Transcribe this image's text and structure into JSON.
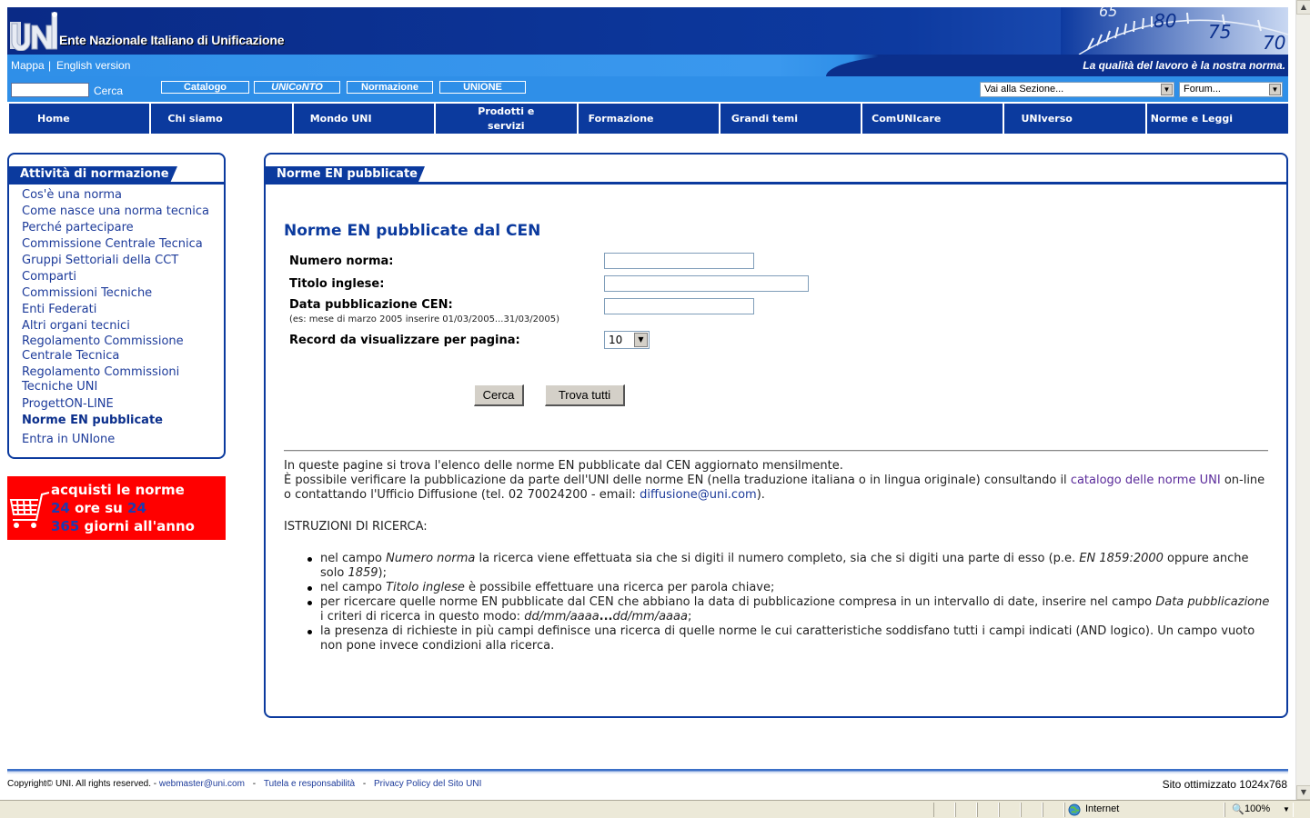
{
  "header": {
    "org_name": "Ente Nazionale Italiano di Unificazione",
    "gauge_numbers": [
      "65",
      "80",
      "75",
      "70"
    ],
    "links": [
      "Mappa",
      "English version"
    ],
    "link_separator": "|",
    "slogan": "La qualità del lavoro è la nostra norma.",
    "search_label": "Cerca",
    "search_value": "",
    "buttons": [
      "Catalogo",
      "UNICoNTO",
      "Normazione",
      "UNIONE"
    ],
    "section_select": "Vai alla Sezione...",
    "forum_select": "Forum..."
  },
  "nav": [
    {
      "label": "Home"
    },
    {
      "label": "Chi siamo"
    },
    {
      "label": "Mondo UNI"
    },
    {
      "label": "Prodotti e servizi"
    },
    {
      "label": "Formazione"
    },
    {
      "label": "Grandi temi"
    },
    {
      "label": "ComUNIcare"
    },
    {
      "label": "UNIverso"
    },
    {
      "label": "Norme e Leggi"
    }
  ],
  "sidebar": {
    "title": "Attività di normazione",
    "items": [
      "Cos'è una norma",
      "Come nasce una norma tecnica",
      "Perché partecipare",
      "Commissione Centrale Tecnica",
      "Gruppi Settoriali della CCT",
      "Comparti",
      "Commissioni Tecniche",
      "Enti Federati",
      "Altri organi tecnici",
      "Regolamento Commissione Centrale Tecnica",
      "Regolamento Commissioni Tecniche UNI",
      "ProgettON-LINE",
      "Norme EN pubblicate",
      "Entra in UNIone"
    ],
    "active_item": "Norme EN pubblicate"
  },
  "promo": {
    "line1": "acquisti le norme",
    "line2_num1": "24",
    "line2_text": " ore su ",
    "line2_num2": "24",
    "line3_num": "365",
    "line3_text": " giorni all'anno"
  },
  "content": {
    "tab_title": "Norme EN pubblicate",
    "heading": "Norme EN pubblicate dal CEN",
    "form": {
      "numero_label": "Numero norma:",
      "numero_value": "",
      "titolo_label": "Titolo inglese:",
      "titolo_value": "",
      "data_label": "Data pubblicazione CEN:",
      "data_hint": "(es: mese di marzo 2005 inserire 01/03/2005...31/03/2005)",
      "data_value": "",
      "records_label": "Record da visualizzare per pagina:",
      "records_value": "10",
      "cerca_button": "Cerca",
      "trova_button": "Trova tutti"
    },
    "intro1": "In queste pagine si trova l'elenco delle norme EN pubblicate dal CEN aggiornato mensilmente.",
    "intro2_a": "È possibile verificare la pubblicazione da parte dell'UNI delle norme EN (nella traduzione italiana o in lingua originale) consultando il ",
    "intro2_link": "catalogo delle norme UNI",
    "intro2_b": " on-line o contattando l'Ufficio Diffusione (tel. 02 70024200 - email: ",
    "intro2_email": "diffusione@uni.com",
    "intro2_c": ").",
    "instructions_title": "ISTRUZIONI DI RICERCA:",
    "instructions": [
      {
        "a": "nel campo ",
        "i1": "Numero norma",
        "b": " la ricerca viene effettuata sia che si digiti il numero completo, sia che si digiti una parte di esso (p.e. ",
        "i2": "EN 1859:2000",
        "c": " oppure anche solo ",
        "i3": "1859",
        "d": ");"
      },
      {
        "a": "nel campo ",
        "i1": "Titolo inglese",
        "b": " è possibile effettuare una ricerca per parola chiave;"
      },
      {
        "a": "per ricercare quelle norme EN pubblicate dal CEN che abbiano la data di pubblicazione compresa in un intervallo di date, inserire nel campo ",
        "i1": "Data pubblicazione",
        "b": " i criteri di ricerca in questo modo: ",
        "i2": "dd/mm/aaaa",
        "bold": "...",
        "i3": "dd/mm/aaaa",
        "c": ";"
      },
      {
        "a": "la presenza di richieste in più campi definisce una ricerca di quelle norme le cui caratteristiche soddisfano tutti i campi indicati (AND logico). Un campo vuoto non pone invece condizioni alla ricerca."
      }
    ]
  },
  "footer": {
    "copyright": "Copyright© UNI. All rights reserved. - ",
    "webmaster": "webmaster@uni.com",
    "sep": " - ",
    "tutela": "Tutela e responsabilità",
    "privacy": "Privacy Policy del Sito UNI",
    "optimized": "Sito ottimizzato 1024x768"
  },
  "statusbar": {
    "zone": "Internet",
    "zoom": "100%"
  },
  "colors": {
    "navy": "#0b3a9e",
    "header_light": "#2f8fe8",
    "promo_red": "#ff0000",
    "link": "#1d3b9a"
  }
}
